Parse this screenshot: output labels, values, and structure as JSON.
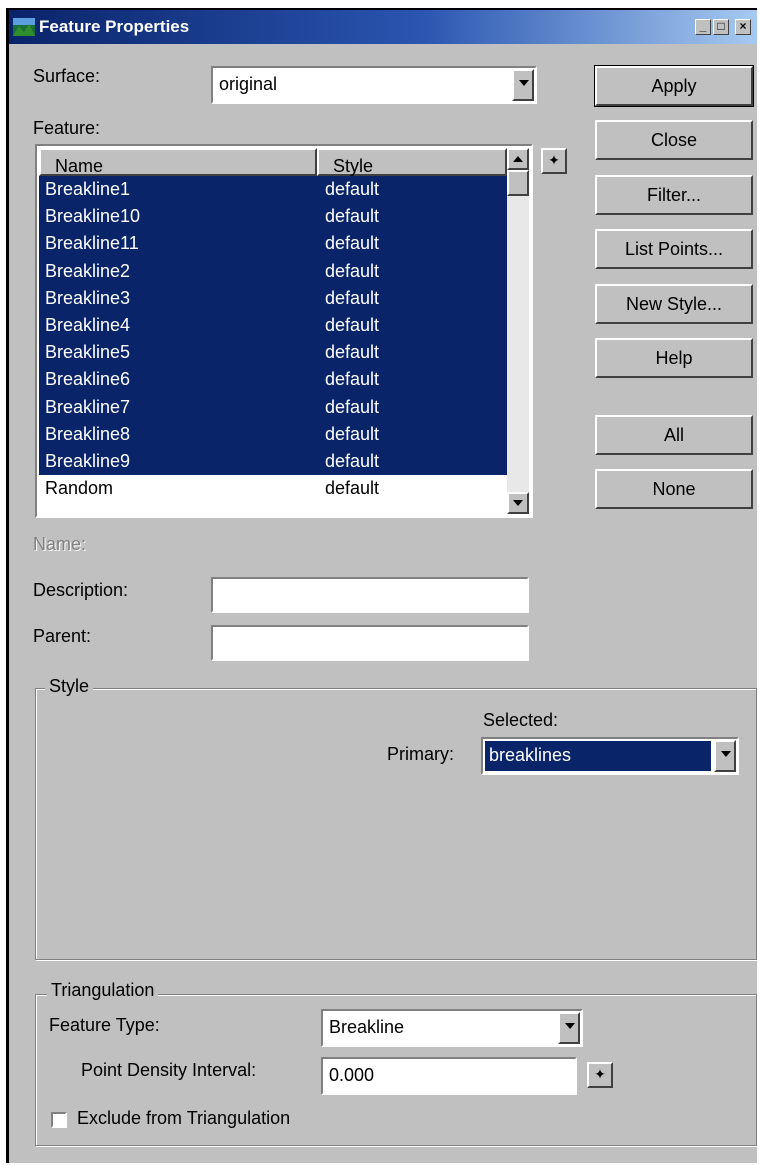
{
  "window": {
    "title": "Feature Properties",
    "controls": [
      "minimize-icon",
      "maximize-icon",
      "close-icon"
    ]
  },
  "surface": {
    "label": "Surface:",
    "value": "original"
  },
  "feature": {
    "label": "Feature:",
    "columns": [
      "Name",
      "Style"
    ],
    "rows": [
      {
        "name": "Breakline1",
        "style": "default",
        "selected": true
      },
      {
        "name": "Breakline10",
        "style": "default",
        "selected": true
      },
      {
        "name": "Breakline11",
        "style": "default",
        "selected": true
      },
      {
        "name": "Breakline2",
        "style": "default",
        "selected": true
      },
      {
        "name": "Breakline3",
        "style": "default",
        "selected": true
      },
      {
        "name": "Breakline4",
        "style": "default",
        "selected": true
      },
      {
        "name": "Breakline5",
        "style": "default",
        "selected": true
      },
      {
        "name": "Breakline6",
        "style": "default",
        "selected": true
      },
      {
        "name": "Breakline7",
        "style": "default",
        "selected": true
      },
      {
        "name": "Breakline8",
        "style": "default",
        "selected": true
      },
      {
        "name": "Breakline9",
        "style": "default",
        "selected": true
      },
      {
        "name": "Random",
        "style": "default",
        "selected": false
      }
    ]
  },
  "buttons": {
    "apply": "Apply",
    "close": "Close",
    "filter": "Filter...",
    "list_points": "List Points...",
    "new_style": "New Style...",
    "help": "Help",
    "all": "All",
    "none": "None"
  },
  "name_label": "Name:",
  "description": {
    "label": "Description:",
    "value": ""
  },
  "parent": {
    "label": "Parent:",
    "value": ""
  },
  "style_group": {
    "label": "Style",
    "selected_label": "Selected:",
    "primary_label": "Primary:",
    "primary_value": "breaklines"
  },
  "triangulation": {
    "label": "Triangulation",
    "feature_type_label": "Feature Type:",
    "feature_type_value": "Breakline",
    "point_density_label": "Point Density Interval:",
    "point_density_value": "0.000",
    "exclude_label": "Exclude from Triangulation",
    "exclude_checked": false
  },
  "colors": {
    "selection": "#0a246a",
    "face": "#c0c0c0"
  }
}
